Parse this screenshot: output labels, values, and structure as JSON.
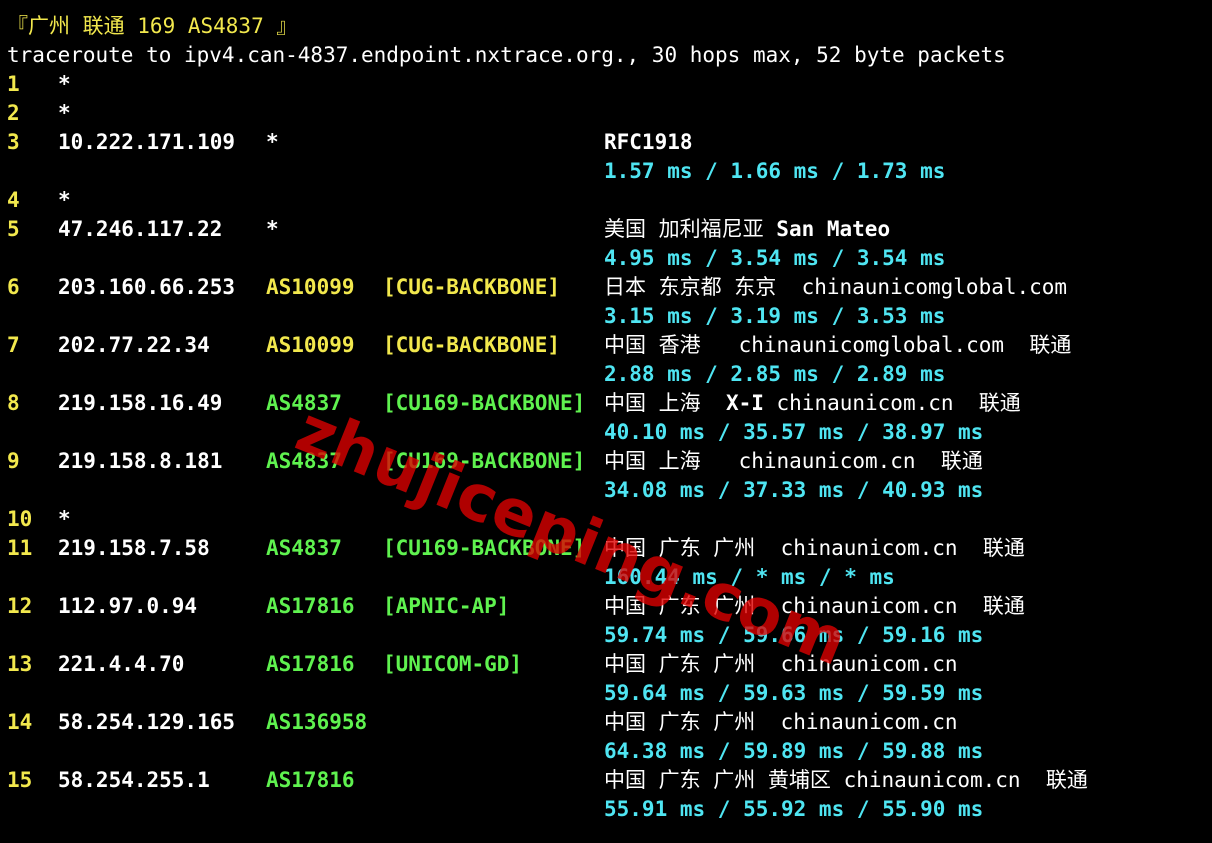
{
  "header": {
    "title": "『广州 联通 169 AS4837 』"
  },
  "command": "traceroute to ipv4.can-4837.endpoint.nxtrace.org., 30 hops max, 52 byte packets",
  "hops": [
    {
      "n": "1",
      "ip": "*"
    },
    {
      "n": "2",
      "ip": "*"
    },
    {
      "n": "3",
      "ip": "10.222.171.109",
      "as": "*",
      "geo": "",
      "geo_bold": "RFC1918",
      "lat": "1.57 ms / 1.66 ms / 1.73 ms"
    },
    {
      "n": "4",
      "ip": "*"
    },
    {
      "n": "5",
      "ip": "47.246.117.22",
      "as": "*",
      "geo": "美国 加利福尼亚 ",
      "geo_bold": "San Mateo",
      "lat": "4.95 ms / 3.54 ms / 3.54 ms"
    },
    {
      "n": "6",
      "ip": "203.160.66.253",
      "as": "AS10099",
      "name": "[CUG-BACKBONE]",
      "geo": "日本 东京都 东京  chinaunicomglobal.com",
      "lat": "3.15 ms / 3.19 ms / 3.53 ms"
    },
    {
      "n": "7",
      "ip": "202.77.22.34",
      "as": "AS10099",
      "name": "[CUG-BACKBONE]",
      "geo": "中国 香港   chinaunicomglobal.com  联通",
      "lat": "2.88 ms / 2.85 ms / 2.89 ms"
    },
    {
      "n": "8",
      "ip": "219.158.16.49",
      "as": "AS4837",
      "name": "[CU169-BACKBONE]",
      "geo": "中国 上海  ",
      "geo_bold": "X-I",
      "geo_tail": " chinaunicom.cn  联通",
      "lat": "40.10 ms / 35.57 ms / 38.97 ms"
    },
    {
      "n": "9",
      "ip": "219.158.8.181",
      "as": "AS4837",
      "name": "[CU169-BACKBONE]",
      "geo": "中国 上海   chinaunicom.cn  联通",
      "lat": "34.08 ms / 37.33 ms / 40.93 ms"
    },
    {
      "n": "10",
      "ip": "*"
    },
    {
      "n": "11",
      "ip": "219.158.7.58",
      "as": "AS4837",
      "name": "[CU169-BACKBONE]",
      "geo": "中国 广东 广州  chinaunicom.cn  联通",
      "lat": "160.44 ms / * ms / * ms"
    },
    {
      "n": "12",
      "ip": "112.97.0.94",
      "as": "AS17816",
      "name": "[APNIC-AP]",
      "geo": "中国 广东 广州  chinaunicom.cn  联通",
      "lat": "59.74 ms / 59.66 ms / 59.16 ms"
    },
    {
      "n": "13",
      "ip": "221.4.4.70",
      "as": "AS17816",
      "name": "[UNICOM-GD]",
      "geo": "中国 广东 广州  chinaunicom.cn",
      "lat": "59.64 ms / 59.63 ms / 59.59 ms"
    },
    {
      "n": "14",
      "ip": "58.254.129.165",
      "as": "AS136958",
      "geo": "中国 广东 广州  chinaunicom.cn",
      "lat": "64.38 ms / 59.89 ms / 59.88 ms"
    },
    {
      "n": "15",
      "ip": "58.254.255.1",
      "as": "AS17816",
      "geo": "中国 广东 广州 黄埔区 chinaunicom.cn  联通",
      "lat": "55.91 ms / 55.92 ms / 55.90 ms"
    }
  ],
  "watermark": "zhujiceping.com",
  "colors": {
    "background": "#000000",
    "hop_number": "#f2e84d",
    "as_number": "#5ff24f",
    "latency": "#4fe5f2",
    "watermark": "#e00000"
  }
}
